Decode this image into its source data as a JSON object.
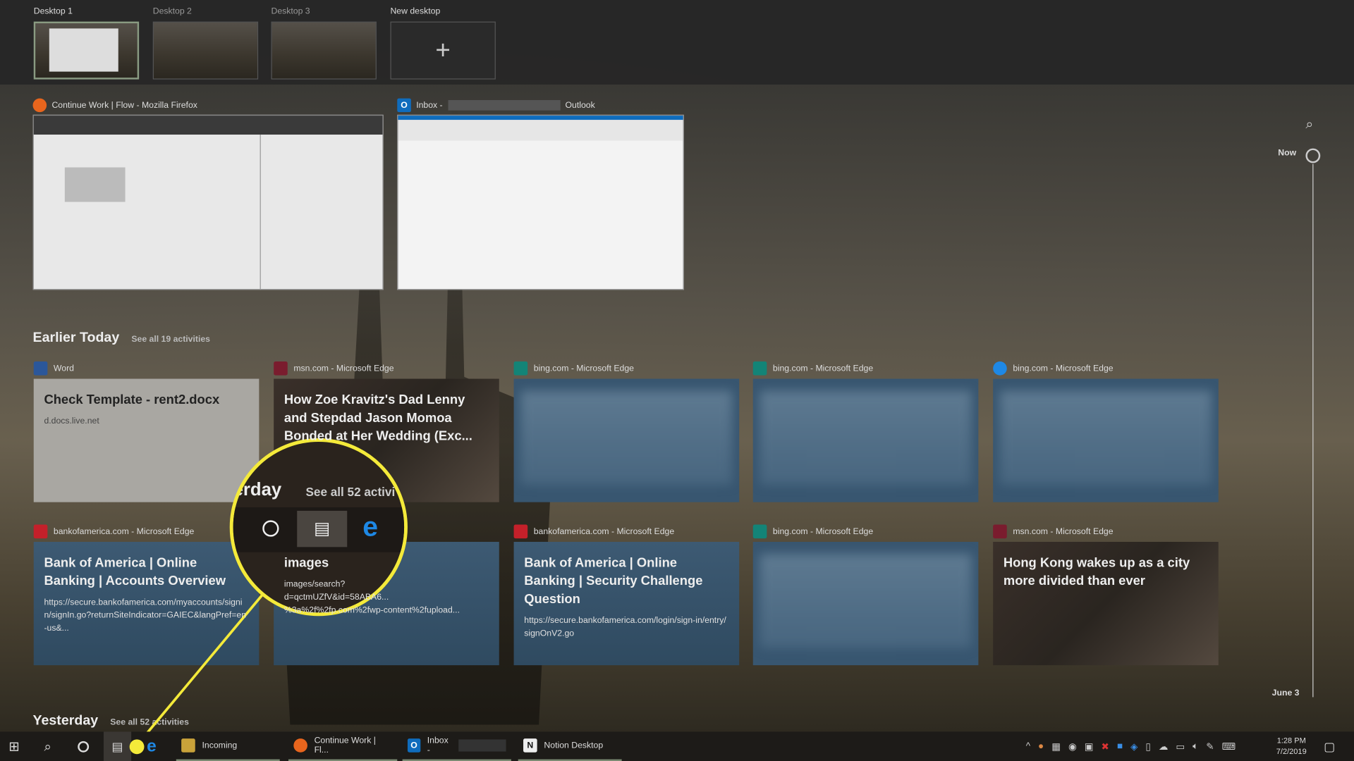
{
  "desktops": [
    {
      "label": "Desktop 1",
      "selected": true
    },
    {
      "label": "Desktop 2"
    },
    {
      "label": "Desktop 3"
    }
  ],
  "new_desktop": {
    "label": "New desktop",
    "icon": "plus-icon"
  },
  "windows": [
    {
      "title": "Continue Work | Flow - Mozilla Firefox",
      "icon": "firefox-icon"
    },
    {
      "title_prefix": "Inbox -",
      "title_suffix": "Outlook",
      "icon": "outlook-icon"
    }
  ],
  "sections": {
    "earlier": {
      "title": "Earlier Today",
      "see_all": "See all 19 activities"
    },
    "yesterday": {
      "title": "Yesterday",
      "see_all": "See all 52 activities"
    }
  },
  "cards_row1": [
    {
      "app": "Word",
      "title": "Check Template - rent2.docx",
      "sub": "d.docs.live.net",
      "icon": "word-icon"
    },
    {
      "app": "msn.com - Microsoft Edge",
      "title": "How Zoe Kravitz's Dad Lenny and Stepdad Jason Momoa Bonded at Her Wedding (Exc...",
      "icon": "msn-icon"
    },
    {
      "app": "bing.com - Microsoft Edge",
      "icon": "bing-icon"
    },
    {
      "app": "bing.com - Microsoft Edge",
      "icon": "bing-icon"
    },
    {
      "app": "bing.com - Microsoft Edge",
      "icon": "edge-icon"
    }
  ],
  "cards_row2": [
    {
      "app": "bankofamerica.com - Microsoft Edge",
      "title": "Bank of America | Online Banking | Accounts Overview",
      "sub": "https://secure.bankofamerica.com/myaccounts/signin/signIn.go?returnSiteIndicator=GAIEC&langPref=en-us&...",
      "icon": "bofa-icon"
    },
    {
      "app": "",
      "title": "images",
      "sub": "images/search?\nd=qctmUZfV&id=58ABA6...\n%3a%2f%2fp.com%2fwp-content%2fupload...",
      "icon": "edge-icon"
    },
    {
      "app": "bankofamerica.com - Microsoft Edge",
      "title": "Bank of America | Online Banking | Security Challenge Question",
      "sub": "https://secure.bankofamerica.com/login/sign-in/entry/signOnV2.go",
      "icon": "bofa-icon"
    },
    {
      "app": "bing.com - Microsoft Edge",
      "icon": "bing-icon"
    },
    {
      "app": "msn.com - Microsoft Edge",
      "title": "Hong Kong wakes up as a city more divided than ever",
      "icon": "msn-icon"
    }
  ],
  "timeline": {
    "now": "Now",
    "bottom": "June 3"
  },
  "magnifier": {
    "text_partial": "erday",
    "see_all_partial": "See all 52 activi"
  },
  "taskbar": {
    "apps": [
      {
        "label": "Incoming",
        "icon": "folder-icon"
      },
      {
        "label": "Continue Work | Fl...",
        "icon": "firefox-icon"
      },
      {
        "label": "Inbox -",
        "icon": "outlook-icon"
      },
      {
        "label": "Notion Desktop",
        "icon": "notion-icon"
      }
    ],
    "time": "1:28 PM",
    "date": "7/2/2019"
  },
  "colors": {
    "highlight": "#f4ea3a",
    "edge": "#1e88e5",
    "accent": "#7a8a72"
  }
}
